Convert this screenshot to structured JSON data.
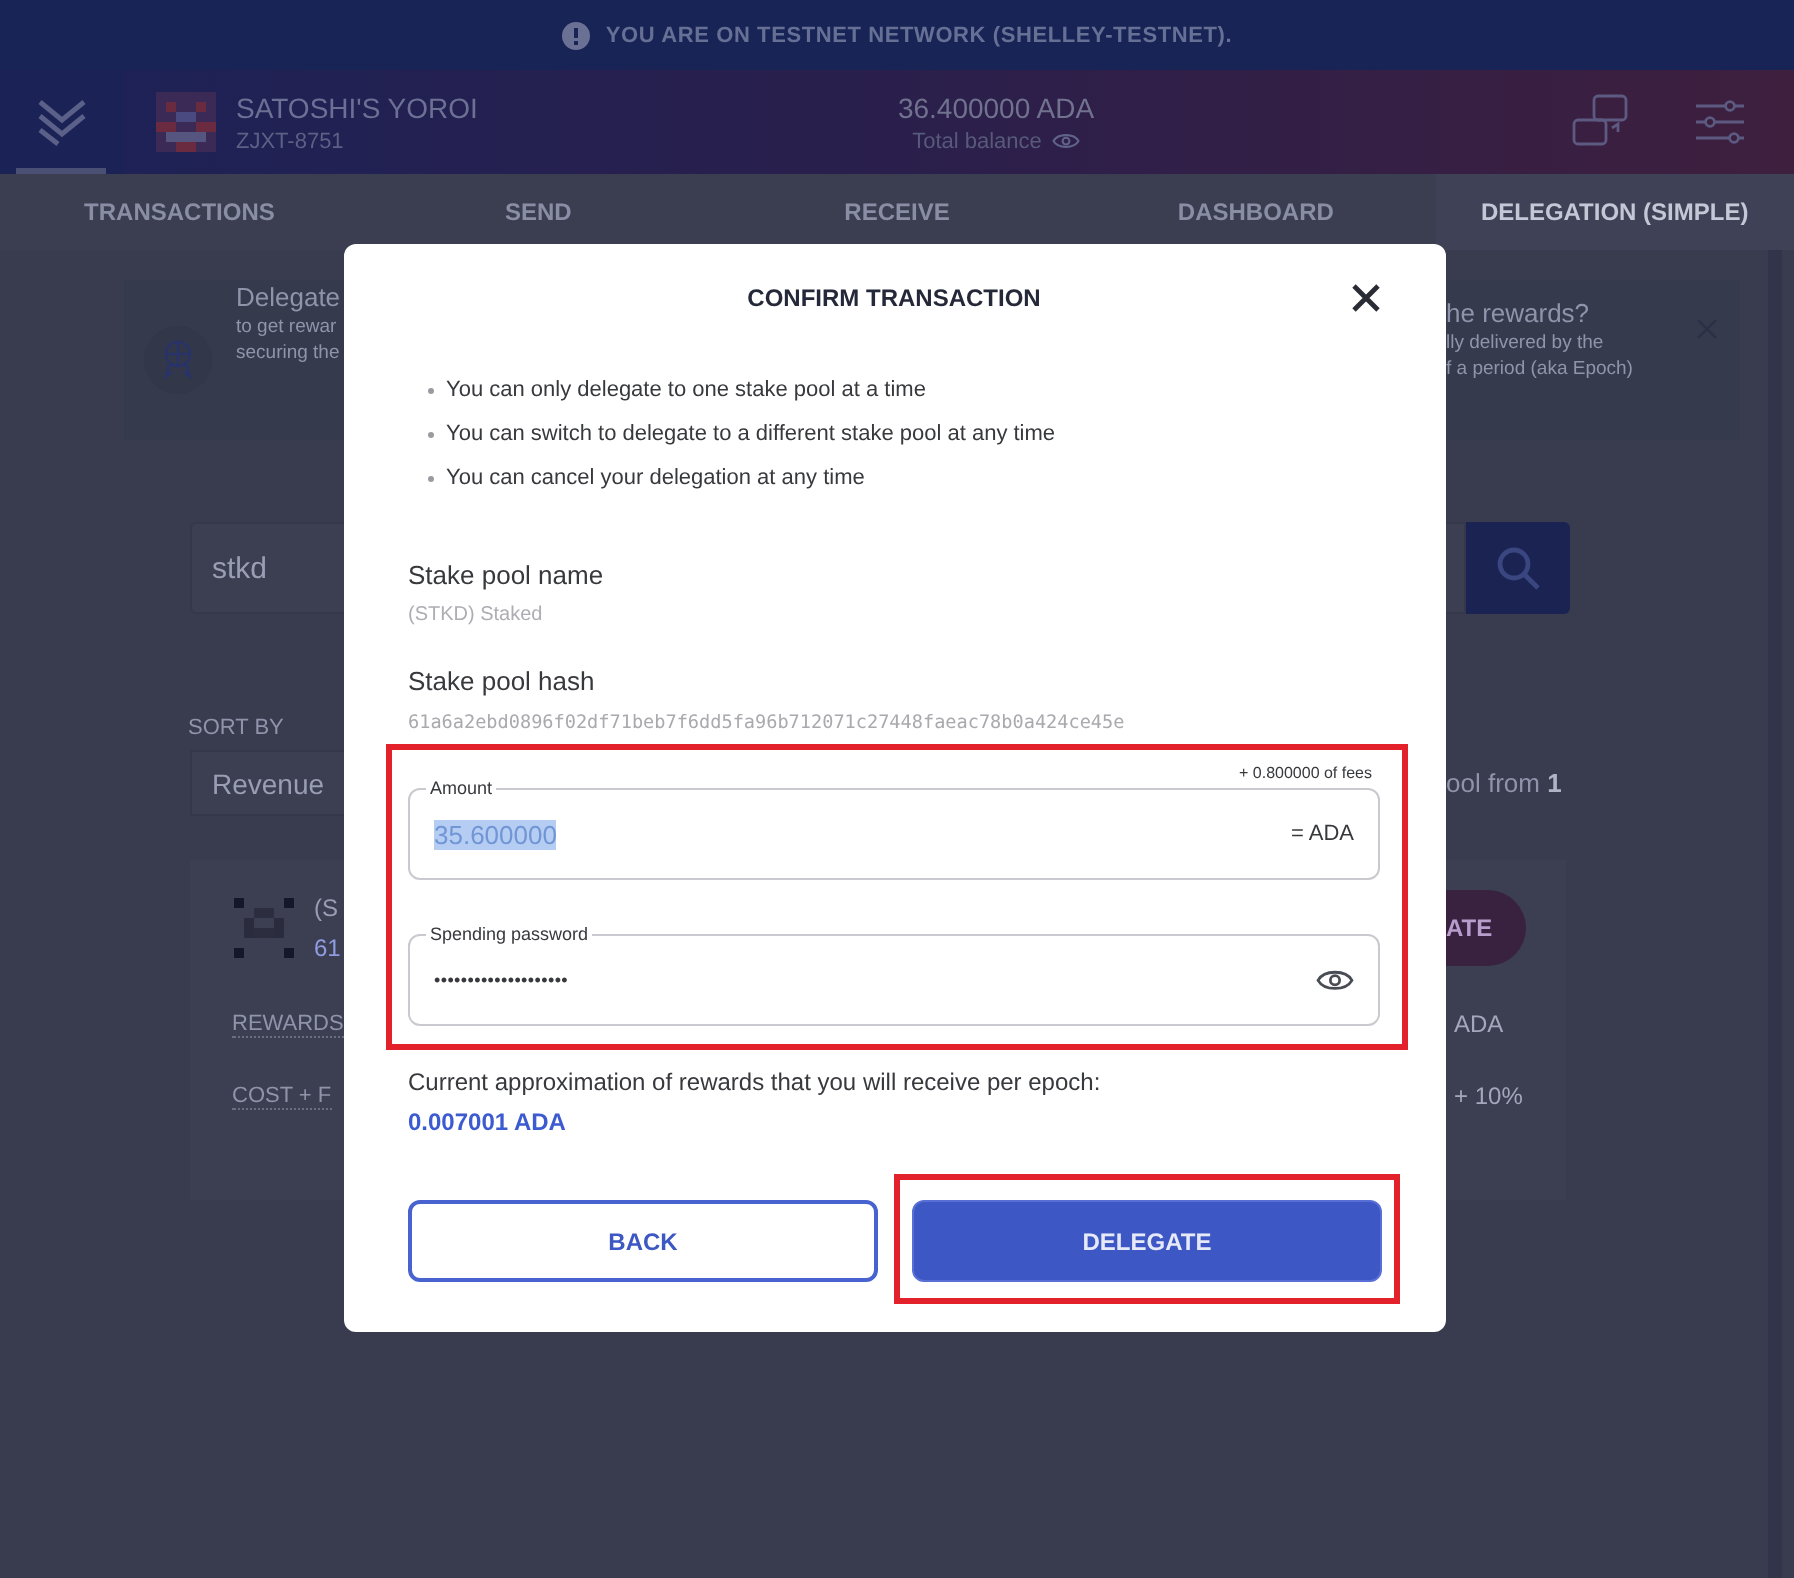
{
  "banner": {
    "text": "YOU ARE ON TESTNET NETWORK (SHELLEY-TESTNET)."
  },
  "header": {
    "wallet_name": "SATOSHI'S YOROI",
    "wallet_id": "ZJXT-8751",
    "balance": "36.400000 ADA",
    "balance_label": "Total balance"
  },
  "tabs": [
    {
      "label": "TRANSACTIONS",
      "selected": false
    },
    {
      "label": "SEND",
      "selected": false
    },
    {
      "label": "RECEIVE",
      "selected": false
    },
    {
      "label": "DASHBOARD",
      "selected": false
    },
    {
      "label": "DELEGATION (SIMPLE)",
      "selected": true
    }
  ],
  "background": {
    "info_left": [
      "Delegate",
      "to get rewar",
      "securing the"
    ],
    "info_right": [
      "he rewards?",
      "lly delivered by the",
      "f a period (aka Epoch)"
    ],
    "search_value": "stkd",
    "sort_label": "SORT BY",
    "sort_value": "Revenue",
    "results_note": "ool from **1**",
    "pool": {
      "name": "(S",
      "hash": "61",
      "button": "ATE",
      "rows": [
        {
          "label": "REWARDS",
          "value": "ADA"
        },
        {
          "label": "COST + F",
          "value": "+ 10%"
        }
      ]
    }
  },
  "modal": {
    "title": "CONFIRM TRANSACTION",
    "bullets": [
      "You can only delegate to one stake pool at a time",
      "You can switch to delegate to a different stake pool at any time",
      "You can cancel your delegation at any time"
    ],
    "pool_name_label": "Stake pool name",
    "pool_name": "(STKD) Staked",
    "pool_hash_label": "Stake pool hash",
    "pool_hash": "61a6a2ebd0896f02df71beb7f6dd5fa96b712071c27448faeac78b0a424ce45e",
    "fields_highlighted": true,
    "amount": {
      "label": "Amount",
      "value": "35.600000",
      "fees": "+ 0.800000 of fees",
      "unit": "= ADA"
    },
    "password": {
      "label": "Spending password",
      "value": "••••••••••••••••••••"
    },
    "rewards_text": "Current approximation of rewards that you will receive per epoch:",
    "rewards_value": "0.007001 ADA",
    "buttons": [
      {
        "label": "BACK",
        "kind": "secondary",
        "highlighted": false
      },
      {
        "label": "DELEGATE",
        "kind": "primary",
        "highlighted": true
      }
    ]
  }
}
